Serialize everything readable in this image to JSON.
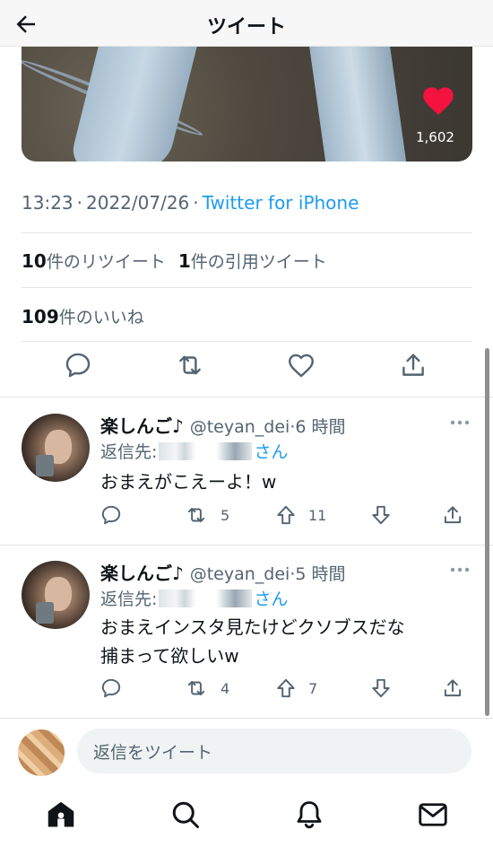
{
  "header": {
    "title": "ツイート",
    "back_icon": "arrow-left-icon"
  },
  "media": {
    "like_count": "1,602",
    "heart_color": "#f4123e"
  },
  "meta": {
    "time": "13:23",
    "separator": "·",
    "date": "2022/07/26",
    "source": "Twitter for iPhone"
  },
  "stats": {
    "retweets_count": "10",
    "retweets_label": "件のリツイート",
    "quotes_count": "1",
    "quotes_label": "件の引用ツイート",
    "likes_count": "109",
    "likes_label": "件のいいね"
  },
  "actions": [
    "reply-icon",
    "retweet-icon",
    "like-icon",
    "share-icon"
  ],
  "replies": [
    {
      "display_name": "楽しんご♪",
      "handle": "@teyan_dei",
      "time": "·6 時間",
      "reply_prefix": "返信先:",
      "reply_suffix": "さん",
      "text": "おまえがこえーよ！w",
      "retweets": "5",
      "upvotes": "11"
    },
    {
      "display_name": "楽しんご♪",
      "handle": "@teyan_dei",
      "time": "·5 時間",
      "reply_prefix": "返信先:",
      "reply_suffix": "さん",
      "text": "おまえインスタ見たけどクソブスだな\n捕まって欲しいw",
      "retweets": "4",
      "upvotes": "7"
    }
  ],
  "composer": {
    "placeholder": "返信をツイート"
  },
  "tabbar": [
    "home-icon",
    "search-icon",
    "notifications-icon",
    "messages-icon"
  ],
  "colors": {
    "accent": "#1d9bf0",
    "secondary_text": "#536471",
    "primary_text": "#0f1419"
  }
}
